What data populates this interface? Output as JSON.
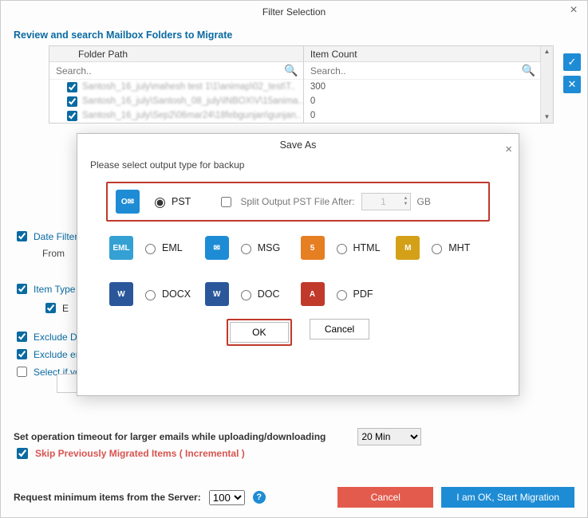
{
  "window": {
    "title": "Filter Selection",
    "section_title": "Review and search Mailbox Folders to Migrate"
  },
  "table": {
    "col_folder": "Folder Path",
    "col_count": "Item Count",
    "search_placeholder": "Search..",
    "rows": [
      {
        "path": "Santosh_16_july\\mahesh test 1\\1\\animap\\02_test\\T..",
        "count": "300"
      },
      {
        "path": "Santosh_16_july\\Santosh_08_july\\INBOX\\V\\15anima..",
        "count": "0"
      },
      {
        "path": "Santosh_16_july\\Sep2\\06mar24\\18febgunjan\\gunjan..",
        "count": "0"
      }
    ]
  },
  "side": {
    "check": "✓",
    "cross": "✕"
  },
  "hidden_opts": {
    "date": "Date Filter",
    "from": "From",
    "item": "Item Type",
    "e": "E",
    "exd": "Exclude De",
    "exe": "Exclude em",
    "sel": "Select if yo"
  },
  "modal": {
    "title": "Save As",
    "subtitle": "Please select output type for backup",
    "pst": "PST",
    "split_lbl": "Split Output PST File After:",
    "split_val": "1",
    "gb": "GB",
    "formats": {
      "eml": "EML",
      "msg": "MSG",
      "html": "HTML",
      "mht": "MHT",
      "docx": "DOCX",
      "doc": "DOC",
      "pdf": "PDF"
    },
    "ok": "OK",
    "cancel": "Cancel"
  },
  "timeout": {
    "label": "Set operation timeout for larger emails while uploading/downloading",
    "value": "20 Min"
  },
  "skip": "Skip Previously Migrated Items ( Incremental )",
  "minreq": {
    "label": "Request minimum items from the Server:",
    "value": "100"
  },
  "footer": {
    "cancel": "Cancel",
    "start": "I am OK, Start Migration"
  }
}
